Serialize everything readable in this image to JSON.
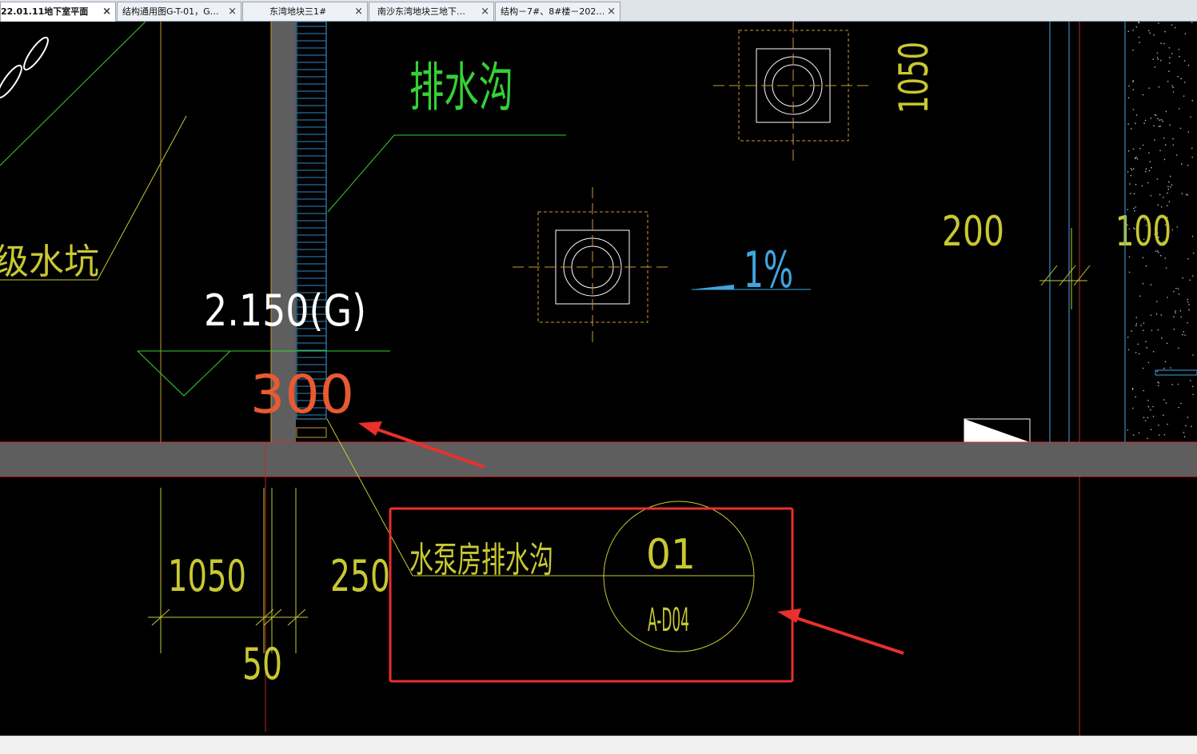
{
  "tabs": [
    {
      "label": "22.01.11地下室平面",
      "active": true
    },
    {
      "label": "结构通用图G-T-01，G…",
      "active": false
    },
    {
      "label": "东湾地块三1#",
      "active": false
    },
    {
      "label": "南沙东湾地块三地下…",
      "active": false
    },
    {
      "label": "结构－7#、8#楼－202…",
      "active": false
    }
  ],
  "close_glyph": "×",
  "drawing": {
    "label_drain_ditch": "排水沟",
    "label_sump": "级水坑",
    "dim_top_right": "1050",
    "dim_200": "200",
    "dim_100": "100",
    "slope": "1%",
    "elevation": "2.150(G)",
    "dim_300": "300",
    "dim_1050": "1050",
    "dim_250": "250",
    "dim_50": "50",
    "detail_title": "水泵房排水沟",
    "detail_number": "01",
    "detail_sheet": "A-D04"
  },
  "colors": {
    "background": "#000000",
    "wall_fill": "#5e5e5e",
    "annotation_red": "#e8302c",
    "cad_yellow": "#c8c832",
    "cad_green": "#35d035",
    "cad_cyan": "#3fa6e0",
    "cad_white": "#ffffff",
    "cad_orange": "#e85a32"
  }
}
